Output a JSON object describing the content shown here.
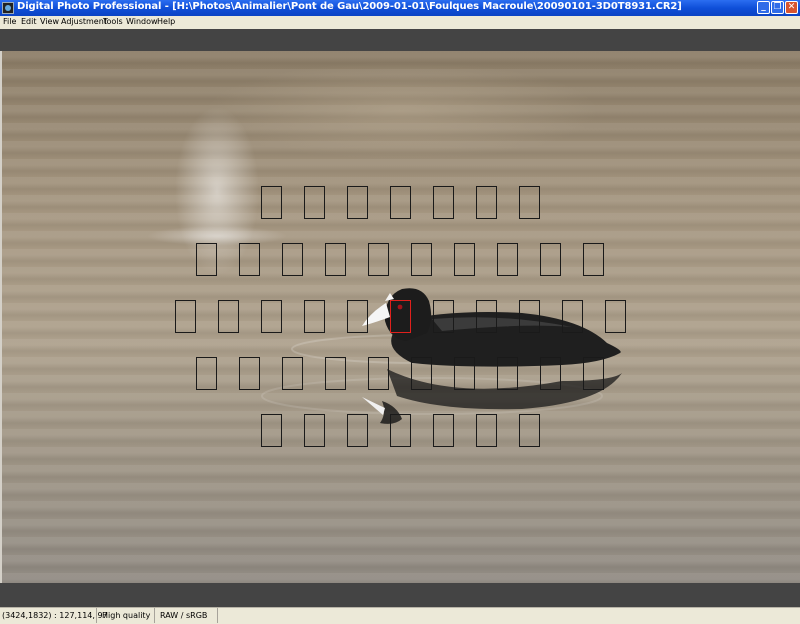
{
  "window": {
    "title": "Digital Photo Professional - [H:\\Photos\\Animalier\\Pont de Gau\\2009-01-01\\Foulques Macroule\\20090101-3D0T8931.CR2]"
  },
  "menu": {
    "items": [
      "File",
      "Edit",
      "View",
      "Adjustment",
      "Tools",
      "Window",
      "Help"
    ]
  },
  "viewer": {
    "af_rows": [
      7,
      10,
      11,
      10,
      7
    ],
    "active_af": {
      "row": 2,
      "col": 5
    }
  },
  "status": {
    "coords": "(3424,1832) : 127,114, 97",
    "quality": "High quality",
    "mode": "RAW / sRGB"
  }
}
